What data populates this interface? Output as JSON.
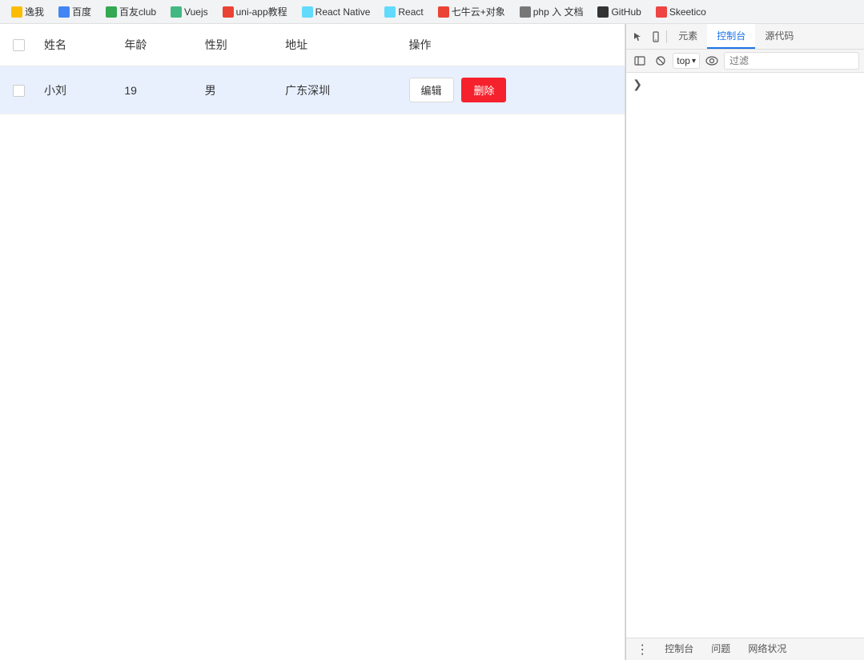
{
  "bookmarks": [
    {
      "label": "逸我",
      "color": "#fbbc04"
    },
    {
      "label": "百度",
      "color": "#4285f4"
    },
    {
      "label": "百友club",
      "color": "#34a853"
    },
    {
      "label": "Vuejs",
      "color": "#42b883"
    },
    {
      "label": "uni-app教程",
      "color": "#ea4335"
    },
    {
      "label": "React Native",
      "color": "#61dafb"
    },
    {
      "label": "React",
      "color": "#61dafb"
    },
    {
      "label": "七牛云+对象",
      "color": "#ea4335"
    },
    {
      "label": "php 入 文档",
      "color": "#777"
    },
    {
      "label": "GitHub",
      "color": "#333"
    },
    {
      "label": "Skeetico",
      "color": "#e44"
    }
  ],
  "table": {
    "headers": [
      {
        "key": "checkbox",
        "label": ""
      },
      {
        "key": "name",
        "label": "姓名"
      },
      {
        "key": "age",
        "label": "年龄"
      },
      {
        "key": "gender",
        "label": "性别"
      },
      {
        "key": "address",
        "label": "地址"
      },
      {
        "key": "actions",
        "label": "操作"
      }
    ],
    "rows": [
      {
        "id": 1,
        "name": "小刘",
        "age": "19",
        "gender": "男",
        "address": "广东深圳",
        "edit_label": "编辑",
        "delete_label": "删除"
      }
    ]
  },
  "devtools": {
    "tabs": [
      {
        "label": "元素",
        "active": false
      },
      {
        "label": "控制台",
        "active": true
      },
      {
        "label": "源代码",
        "active": false
      }
    ],
    "toolbar": {
      "context_label": "top",
      "filter_placeholder": "过滤"
    },
    "bottom_tabs": [
      {
        "label": "控制台"
      },
      {
        "label": "问题"
      },
      {
        "label": "网络状况"
      }
    ]
  }
}
